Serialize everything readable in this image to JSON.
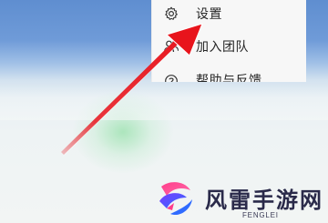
{
  "menu": {
    "items": [
      {
        "label": "设置",
        "icon": "gear-icon"
      },
      {
        "label": "加入团队",
        "icon": "team-icon"
      },
      {
        "label": "帮助与反馈",
        "icon": "help-icon"
      }
    ]
  },
  "annotation": {
    "icon": "red-arrow-icon",
    "color": "#e8141c"
  },
  "watermark": {
    "title": "风雷手游网",
    "subtitle": "FENGLEI",
    "icon": "fenglei-logo-icon",
    "colors": {
      "pink": "#ff3d8a",
      "purple": "#7a3cff",
      "blue": "#2f6bff"
    }
  }
}
